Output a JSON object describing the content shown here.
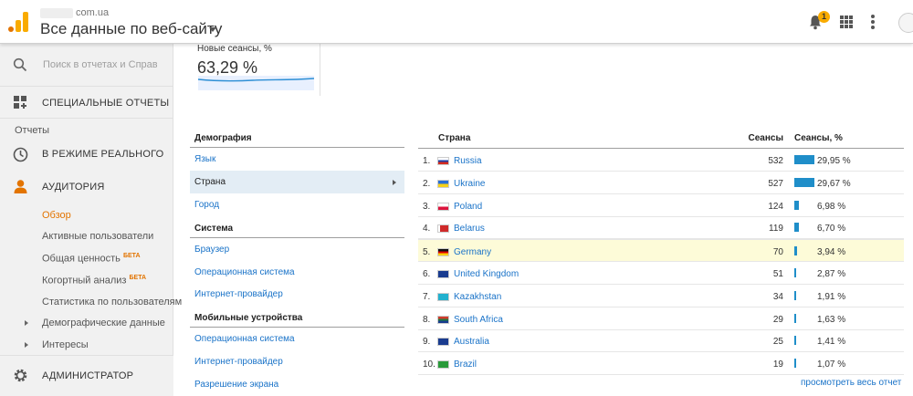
{
  "header": {
    "account_domain": "com.ua",
    "view_title": "Все данные по веб-сайту",
    "notifications_count": "1"
  },
  "sidebar": {
    "search_placeholder": "Поиск в отчетах и Справке",
    "custom_reports": "СПЕЦИАЛЬНЫЕ ОТЧЕТЫ",
    "reports_label": "Отчеты",
    "realtime": "В РЕЖИМЕ РЕАЛЬНОГО",
    "audience": "АУДИТОРИЯ",
    "audience_items": [
      {
        "label": "Обзор",
        "beta": ""
      },
      {
        "label": "Активные пользователи",
        "beta": ""
      },
      {
        "label": "Общая ценность",
        "beta": "БЕТА"
      },
      {
        "label": "Когортный анализ",
        "beta": "БЕТА"
      },
      {
        "label": "Статистика по пользователям",
        "beta": ""
      }
    ],
    "demographics": "Демографические данные",
    "interests": "Интересы",
    "admin": "АДМИНИСТРАТОР"
  },
  "metric": {
    "label": "Новые сеансы, %",
    "value": "63,29 %"
  },
  "dimensions": {
    "groups": [
      {
        "heading": "Демография",
        "items": [
          "Язык",
          "Страна",
          "Город"
        ],
        "selected": "Страна"
      },
      {
        "heading": "Система",
        "items": [
          "Браузер",
          "Операционная система",
          "Интернет-провайдер"
        ]
      },
      {
        "heading": "Мобильные устройства",
        "items": [
          "Операционная система",
          "Интернет-провайдер",
          "Разрешение экрана"
        ]
      }
    ]
  },
  "table": {
    "headers": {
      "country": "Страна",
      "sessions": "Сеансы",
      "sessions_pct": "Сеансы, %"
    },
    "rows": [
      {
        "rank": "1.",
        "country": "Russia",
        "flag": "ru",
        "sessions": "532",
        "pct": "29,95 %",
        "share": 29.95
      },
      {
        "rank": "2.",
        "country": "Ukraine",
        "flag": "ua",
        "sessions": "527",
        "pct": "29,67 %",
        "share": 29.67
      },
      {
        "rank": "3.",
        "country": "Poland",
        "flag": "pl",
        "sessions": "124",
        "pct": "6,98 %",
        "share": 6.98
      },
      {
        "rank": "4.",
        "country": "Belarus",
        "flag": "by",
        "sessions": "119",
        "pct": "6,70 %",
        "share": 6.7
      },
      {
        "rank": "5.",
        "country": "Germany",
        "flag": "de",
        "sessions": "70",
        "pct": "3,94 %",
        "share": 3.94
      },
      {
        "rank": "6.",
        "country": "United Kingdom",
        "flag": "uk",
        "sessions": "51",
        "pct": "2,87 %",
        "share": 2.87
      },
      {
        "rank": "7.",
        "country": "Kazakhstan",
        "flag": "kz",
        "sessions": "34",
        "pct": "1,91 %",
        "share": 1.91
      },
      {
        "rank": "8.",
        "country": "South Africa",
        "flag": "za",
        "sessions": "29",
        "pct": "1,63 %",
        "share": 1.63
      },
      {
        "rank": "9.",
        "country": "Australia",
        "flag": "au",
        "sessions": "25",
        "pct": "1,41 %",
        "share": 1.41
      },
      {
        "rank": "10.",
        "country": "Brazil",
        "flag": "br",
        "sessions": "19",
        "pct": "1,07 %",
        "share": 1.07
      }
    ],
    "view_all": "просмотреть весь отчет"
  },
  "colors": {
    "accent": "#e37400",
    "link": "#1a73c8",
    "bar": "#1f8ec9",
    "highlight": "#fdfbd8"
  }
}
